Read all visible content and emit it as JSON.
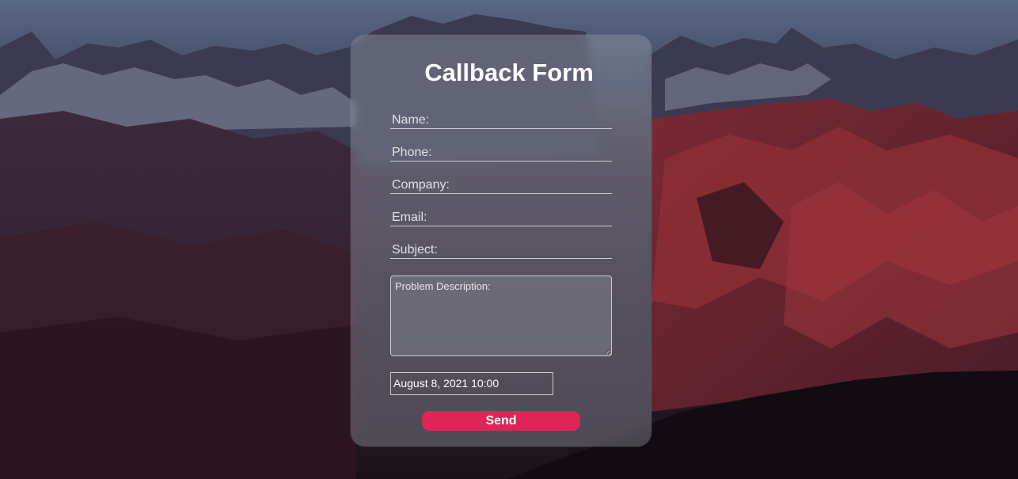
{
  "form": {
    "title": "Callback Form",
    "name_placeholder": "Name:",
    "phone_placeholder": "Phone:",
    "company_placeholder": "Company:",
    "email_placeholder": "Email:",
    "subject_placeholder": "Subject:",
    "description_placeholder": "Problem Description:",
    "datetime_value": "August 8, 2021 10:00",
    "send_label": "Send"
  },
  "colors": {
    "send_button": "#e0245a",
    "title_text": "#ffffff"
  }
}
